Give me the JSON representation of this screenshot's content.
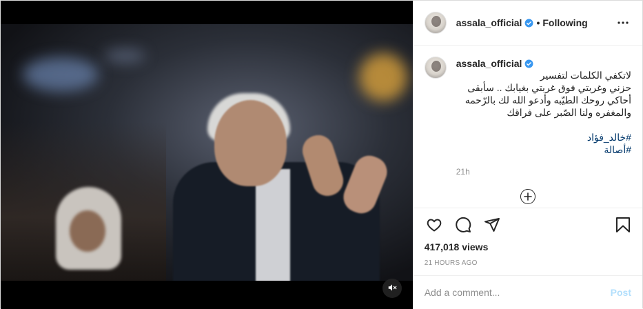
{
  "post": {
    "username": "assala_official",
    "separator": "•",
    "follow_status": "Following",
    "caption": {
      "username": "assala_official",
      "text": "لاتكفي الكلمات لتفسير\nحزني وغربتي فوق غربتي بغيابك .. سأبقى\nأحاكي روحك الطيّبه وأدعو الله لك بالرّحمه\nوالمغفره ولنا الصّبر على فراقك",
      "hashtags": [
        "#خالد_فؤاد",
        "#أصالة"
      ],
      "relative_time": "21h"
    },
    "views": "417,018 views",
    "posted_ago": "21 HOURS AGO"
  },
  "comment_box": {
    "placeholder": "Add a comment...",
    "post_label": "Post"
  },
  "icons": {
    "verified": "verified-badge-icon",
    "more": "more-options-icon",
    "load_more": "load-more-comments-icon",
    "like": "heart-icon",
    "comment": "comment-icon",
    "share": "share-icon",
    "save": "bookmark-icon",
    "mute": "muted-speaker-icon"
  },
  "colors": {
    "verified_blue": "#3897f0",
    "hashtag_link": "#00376b",
    "post_button_disabled": "#b2dffc",
    "muted_text": "#8e8e8e"
  }
}
